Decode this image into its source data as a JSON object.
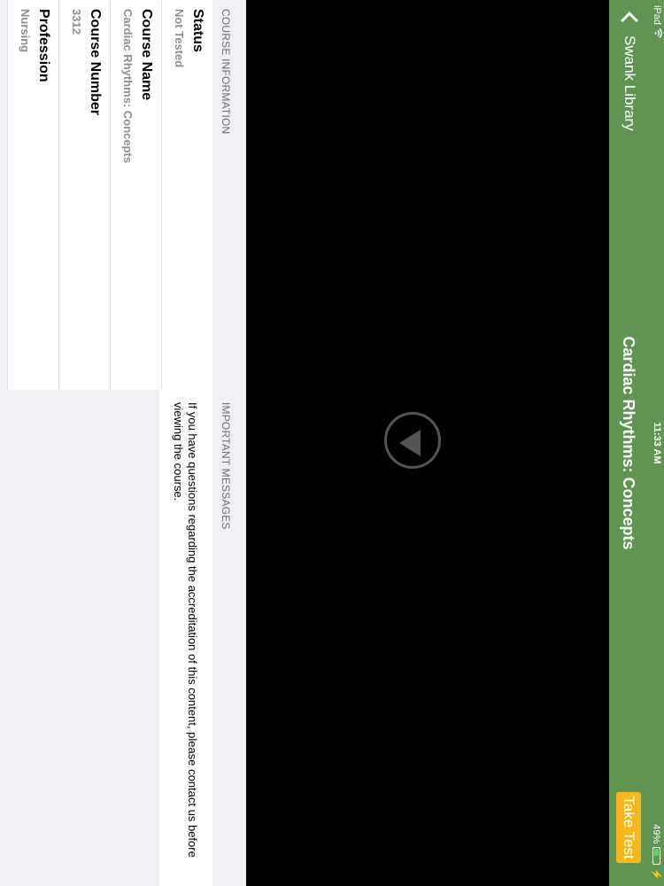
{
  "status_bar": {
    "device": "iPad",
    "time": "11:33 AM",
    "battery": "49%",
    "battery_level": 0.49
  },
  "nav": {
    "back_label": "Swank Library",
    "title": "Cardiac Rhythms: Concepts",
    "take_test_label": "Take Test"
  },
  "course_info": {
    "header": "COURSE INFORMATION",
    "rows": [
      {
        "label": "Status",
        "value": "Not Tested"
      },
      {
        "label": "Course Name",
        "value": "Cardiac Rhythms: Concepts"
      },
      {
        "label": "Course Number",
        "value": "3312"
      },
      {
        "label": "Profession",
        "value": "Nursing"
      }
    ]
  },
  "messages": {
    "header": "IMPORTANT MESSAGES",
    "text": "If you have questions regarding the accreditation of this content, please contact us before viewing the course."
  },
  "colors": {
    "nav_green": "#5f9550",
    "take_test": "#f5b81c",
    "video_bg": "#000000"
  }
}
